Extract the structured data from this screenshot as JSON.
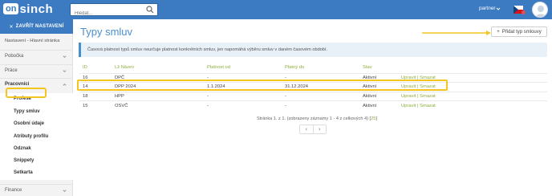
{
  "header": {
    "logo_on": "on",
    "logo_rest": "sinch",
    "search_placeholder": "Hledat...",
    "user_name": "partner",
    "icons": [
      "search-icon",
      "chevron-down-icon",
      "flag-icon",
      "avatar"
    ]
  },
  "sidebar": {
    "close_label": "ZAVŘÍT NASTAVENÍ",
    "breadcrumb": "Nastavení - Hlavní stránka",
    "sections": [
      {
        "label": "Pobočka"
      },
      {
        "label": "Práce"
      },
      {
        "label": "Pracovníci"
      }
    ],
    "submenu": [
      {
        "label": "Profese"
      },
      {
        "label": "Typy smluv"
      },
      {
        "label": "Osobní údaje"
      },
      {
        "label": "Atributy profilu"
      },
      {
        "label": "Odznak"
      },
      {
        "label": "Snippety"
      },
      {
        "label": "Setkarta"
      }
    ],
    "finance_label": "Finance"
  },
  "main": {
    "title": "Typy smluv",
    "add_button": "Přidat typ smlouvy",
    "info": "Časová platnost typů smluv neurčuje platnost konkrétních smluv, jen napomáhá výběru smluv v daném časovém období.",
    "columns": [
      "ID",
      "Lž Název",
      "Platnost od",
      "Platný do",
      "Stav",
      ""
    ],
    "rows": [
      {
        "id": "16",
        "name": "DPČ",
        "from": "-",
        "to": "-",
        "state": "Aktivní",
        "edit": "Upravit",
        "delete": "Smazat"
      },
      {
        "id": "14",
        "name": "DPP 2024",
        "from": "1.1.2024",
        "to": "31.12.2024",
        "state": "Aktivní",
        "edit": "Upravit",
        "delete": "Smazat"
      },
      {
        "id": "18",
        "name": "HPP",
        "from": "-",
        "to": "-",
        "state": "Aktivní",
        "edit": "Upravit",
        "delete": "Smazat"
      },
      {
        "id": "15",
        "name": "OSVČ",
        "from": "-",
        "to": "-",
        "state": "Aktivní",
        "edit": "Upravit",
        "delete": "Smazat"
      }
    ],
    "separator": "|",
    "pager_text": "Stránka 1. z 1. (zobrazeny záznamy 1 - 4 z celkových 4) [",
    "pager_size": "25",
    "pager_close": "]",
    "prev": "‹",
    "next": "›"
  },
  "colors": {
    "header_blue": "#3c7bc1",
    "accent_green": "#8cae3e",
    "highlight_yellow": "#f3c520"
  }
}
